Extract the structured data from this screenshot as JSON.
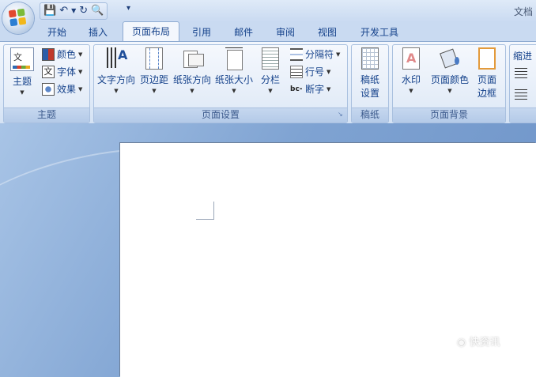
{
  "window": {
    "title": "文档"
  },
  "tabs": [
    "开始",
    "插入",
    "页面布局",
    "引用",
    "邮件",
    "审阅",
    "视图",
    "开发工具"
  ],
  "active_tab": "页面布局",
  "ribbon": {
    "theme": {
      "group": "主题",
      "big": "主题",
      "colors": "颜色",
      "fonts": "字体",
      "effects": "效果"
    },
    "page_setup": {
      "group": "页面设置",
      "text_direction": "文字方向",
      "margins": "页边距",
      "orientation": "纸张方向",
      "size": "纸张大小",
      "columns": "分栏",
      "breaks": "分隔符",
      "line_numbers": "行号",
      "hyphenation": "断字"
    },
    "manuscript": {
      "group": "稿纸",
      "setup_line1": "稿纸",
      "setup_line2": "设置"
    },
    "page_background": {
      "group": "页面背景",
      "watermark": "水印",
      "page_color": "页面颜色",
      "borders_line1": "页面",
      "borders_line2": "边框"
    },
    "paragraph": {
      "indent": "缩进"
    }
  },
  "colors": {
    "accent": "#15428b",
    "ribbon_bg": "#e2ecf9",
    "doc_bg": "#7fa3d2"
  }
}
